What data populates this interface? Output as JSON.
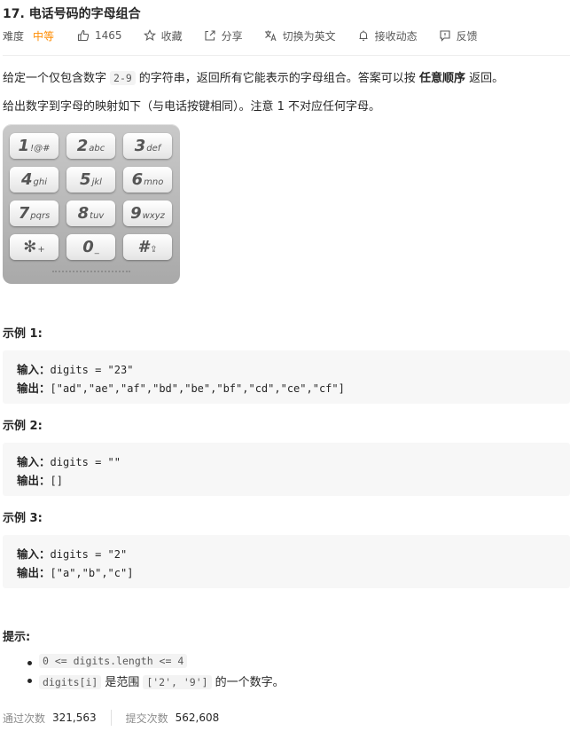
{
  "problem": {
    "title": "17. 电话号码的字母组合",
    "difficulty_label": "难度",
    "difficulty": "中等",
    "likes": "1465",
    "collect": "收藏",
    "share": "分享",
    "switch_lang": "切换为英文",
    "subscribe": "接收动态",
    "feedback": "反馈"
  },
  "description": {
    "p1_before": "给定一个仅包含数字",
    "p1_code": "2-9",
    "p1_middle": "的字符串，返回所有它能表示的字母组合。答案可以按",
    "p1_bold": "任意顺序",
    "p1_after": "返回。",
    "p2": "给出数字到字母的映射如下（与电话按键相同）。注意 1 不对应任何字母。"
  },
  "keypad": {
    "keys": [
      {
        "digit": "1",
        "letters": "!@#"
      },
      {
        "digit": "2",
        "letters": "abc"
      },
      {
        "digit": "3",
        "letters": "def"
      },
      {
        "digit": "4",
        "letters": "ghi"
      },
      {
        "digit": "5",
        "letters": "jkl"
      },
      {
        "digit": "6",
        "letters": "mno"
      },
      {
        "digit": "7",
        "letters": "pqrs"
      },
      {
        "digit": "8",
        "letters": "tuv"
      },
      {
        "digit": "9",
        "letters": "wxyz"
      },
      {
        "digit": "✻",
        "letters": "+"
      },
      {
        "digit": "0",
        "letters": "_"
      },
      {
        "digit": "#",
        "letters": "⇪"
      }
    ]
  },
  "examples": [
    {
      "title": "示例 1:",
      "input_label": "输入：",
      "input": "digits = \"23\"",
      "output_label": "输出：",
      "output": "[\"ad\",\"ae\",\"af\",\"bd\",\"be\",\"bf\",\"cd\",\"ce\",\"cf\"]"
    },
    {
      "title": "示例 2:",
      "input_label": "输入：",
      "input": "digits = \"\"",
      "output_label": "输出：",
      "output": "[]"
    },
    {
      "title": "示例 3:",
      "input_label": "输入：",
      "input": "digits = \"2\"",
      "output_label": "输出：",
      "output": "[\"a\",\"b\",\"c\"]"
    }
  ],
  "hints": {
    "title": "提示:",
    "h1_code": "0 <= digits.length <= 4",
    "h2_code1": "digits[i]",
    "h2_text1": "是范围",
    "h2_code2": "['2', '9']",
    "h2_text2": "的一个数字。"
  },
  "stats": {
    "accepted_label": "通过次数",
    "accepted": "321,563",
    "submissions_label": "提交次数",
    "submissions": "562,608"
  },
  "colors": {
    "difficulty_medium": "#ff8c00",
    "code_bg": "#f7f7f7"
  }
}
